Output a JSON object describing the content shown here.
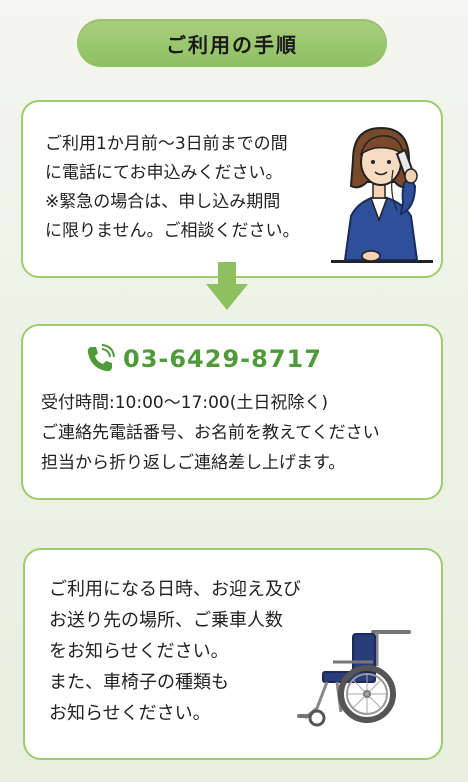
{
  "title": "ご利用の手順",
  "step1": {
    "lines": [
      "ご利用1か月前～3日前までの間",
      "に電話にてお申込みください。",
      "※緊急の場合は、申し込み期間",
      "に限りません。ご相談ください。"
    ]
  },
  "step2": {
    "phone": "03-6429-8717",
    "lines": [
      "受付時間:10:00～17:00(土日祝除く)",
      "ご連絡先電話番号、お名前を教えてください",
      "担当から折り返しご連絡差し上げます。"
    ]
  },
  "step3": {
    "lines": [
      "ご利用になる日時、お迎え及び",
      "お送り先の場所、ご乗車人数",
      "をお知らせください。",
      "また、車椅子の種類も",
      "お知らせください。"
    ]
  },
  "colors": {
    "accent_green": "#9ccc6e",
    "phone_green": "#4f9b3a",
    "pill_green": "#97c46c"
  },
  "icons": [
    "phone-icon",
    "down-arrow-icon",
    "operator-illustration",
    "wheelchair-illustration"
  ]
}
